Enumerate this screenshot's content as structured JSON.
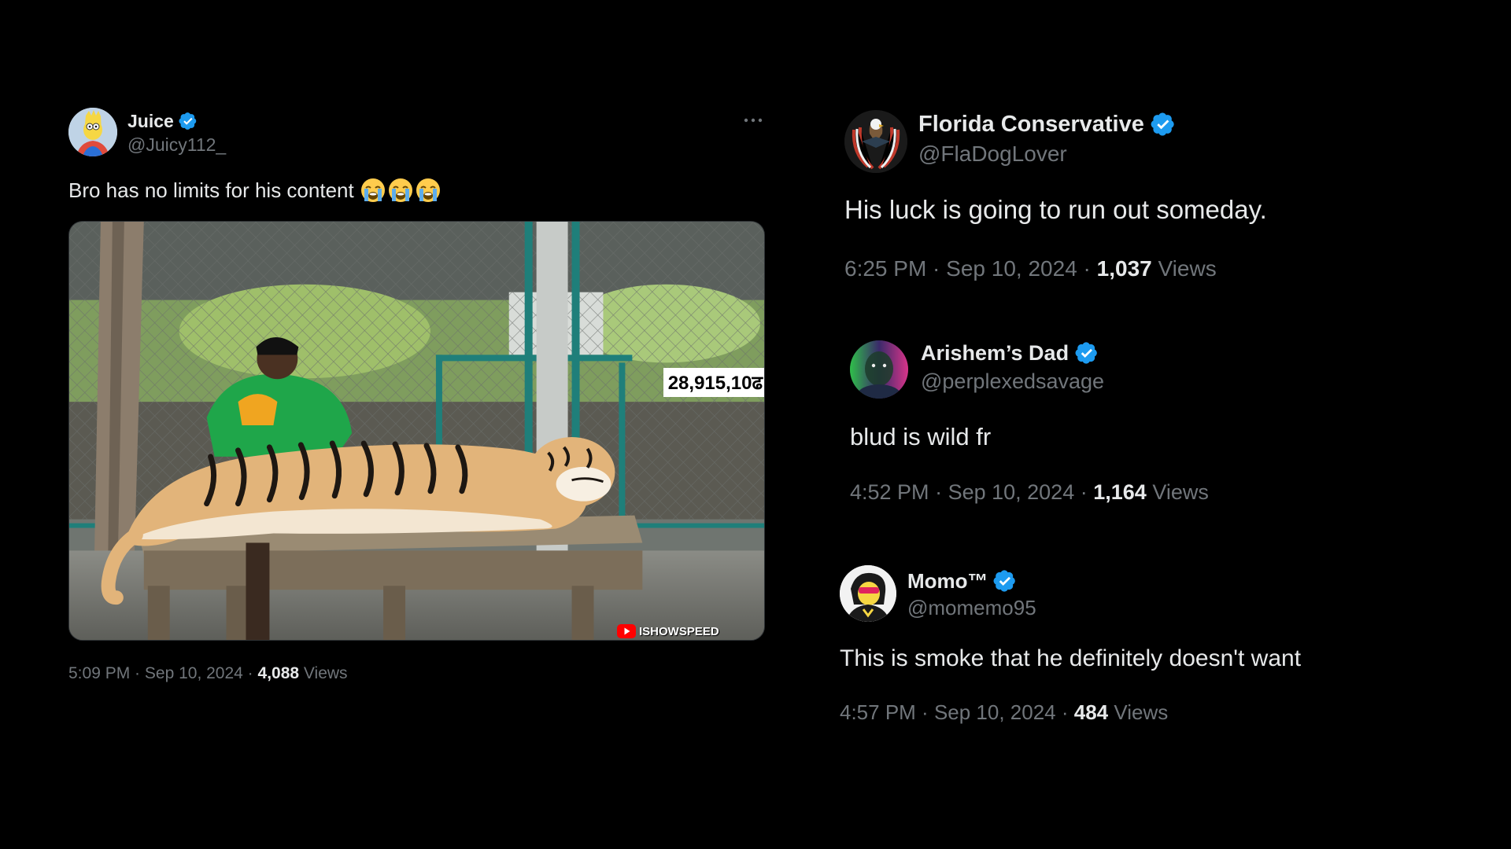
{
  "accent_color": "#1d9bf0",
  "main_tweet": {
    "display_name": "Juice",
    "handle": "@Juicy112_",
    "text": "Bro has no limits for his content",
    "emoji": [
      "loudly-crying-face",
      "loudly-crying-face",
      "loudly-crying-face"
    ],
    "media": {
      "overlay_counter": "28,915,10ढ",
      "watermark": "ISHOWSPEED"
    },
    "time": "5:09 PM",
    "date": "Sep 10, 2024",
    "views_count": "4,088",
    "views_label": "Views"
  },
  "replies": [
    {
      "display_name": "Florida Conservative",
      "handle": "@FlaDogLover",
      "text": "His luck is going to run out someday.",
      "time": "6:25 PM",
      "date": "Sep 10, 2024",
      "views_count": "1,037",
      "views_label": "Views"
    },
    {
      "display_name": "Arishem’s Dad",
      "handle": "@perplexedsavage",
      "text": "blud is wild fr",
      "time": "4:52 PM",
      "date": "Sep 10, 2024",
      "views_count": "1,164",
      "views_label": "Views"
    },
    {
      "display_name": "Momo™",
      "handle": "@momemo95",
      "text": "This is smoke that he definitely doesn't want",
      "time": "4:57 PM",
      "date": "Sep 10, 2024",
      "views_count": "484",
      "views_label": "Views"
    }
  ]
}
